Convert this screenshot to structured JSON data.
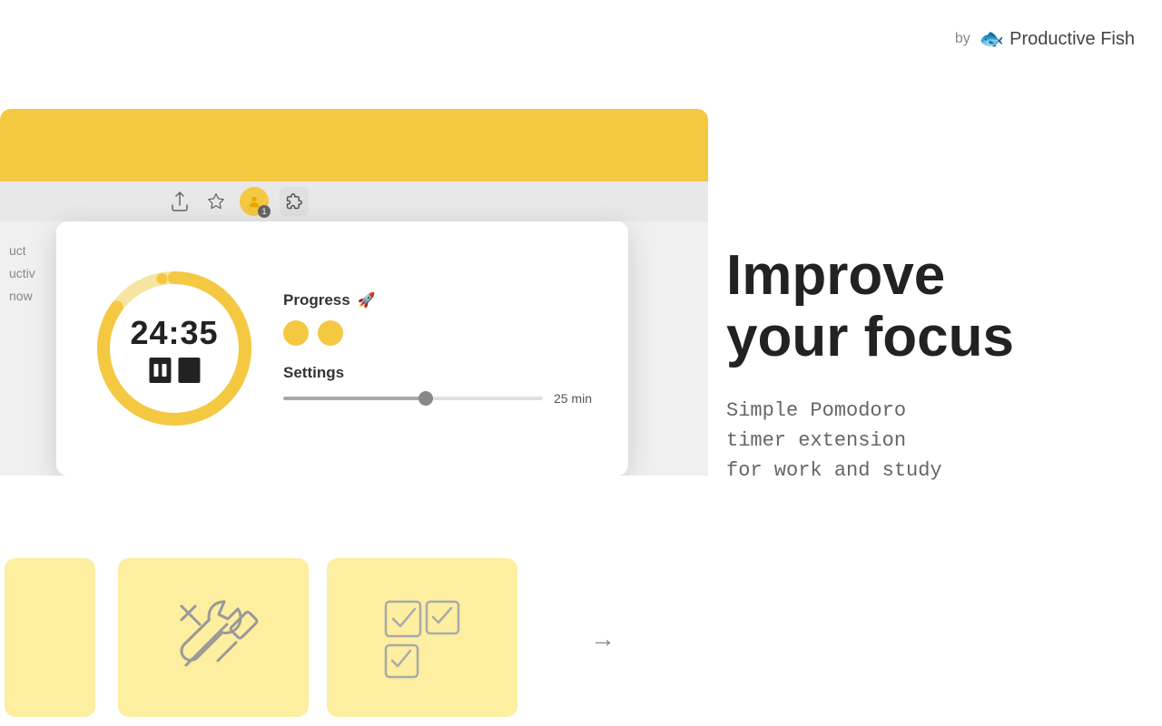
{
  "brand": {
    "by_label": "by",
    "name": "Productive Fish",
    "fish_emoji": "🐟"
  },
  "browser": {
    "tab_bar": {
      "share_icon": "⬆",
      "star_icon": "☆",
      "badge_number": "1",
      "puzzle_icon": "🧩"
    }
  },
  "popup": {
    "timer": {
      "display": "24:35",
      "pause_label": "pause",
      "stop_label": "stop"
    },
    "progress": {
      "title": "Progress",
      "tomato_count": 2
    },
    "settings": {
      "title": "Settings",
      "slider_value": "25 min",
      "slider_percent": 55
    }
  },
  "hero": {
    "headline_line1": "Improve",
    "headline_line2": "your focus",
    "subtitle_line1": "Simple Pomodoro",
    "subtitle_line2": "timer extension",
    "subtitle_line3": "for work and study"
  },
  "left_partial_text": {
    "line1": "uct",
    "line2": "uctiv",
    "line3": "now"
  }
}
